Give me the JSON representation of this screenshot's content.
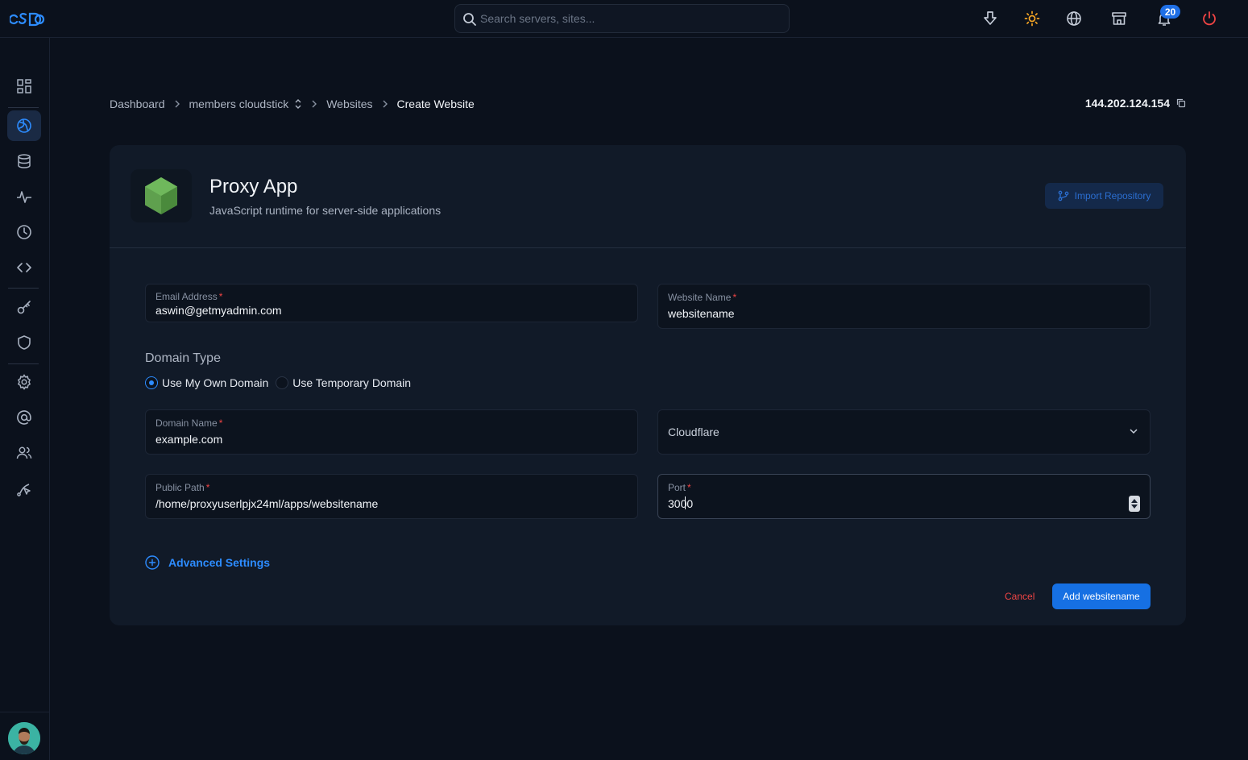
{
  "topbar": {
    "search_placeholder": "Search servers, sites...",
    "notification_count": "20"
  },
  "breadcrumb": {
    "items": [
      "Dashboard",
      "members cloudstick",
      "Websites",
      "Create Website"
    ]
  },
  "server_ip": "144.202.124.154",
  "app": {
    "title": "Proxy App",
    "subtitle": "JavaScript runtime for server-side applications",
    "import_label": "Import Repository"
  },
  "form": {
    "email": {
      "label": "Email Address",
      "value": "aswin@getmyadmin.com"
    },
    "website_name": {
      "label": "Website Name",
      "value": "websitename"
    },
    "domain_type": {
      "title": "Domain Type",
      "options": [
        "Use My Own Domain",
        "Use Temporary Domain"
      ],
      "selected": "Use My Own Domain"
    },
    "domain_name": {
      "label": "Domain Name",
      "value": "example.com"
    },
    "dns_provider": {
      "value": "Cloudflare"
    },
    "public_path": {
      "label": "Public Path",
      "value": "/home/proxyuserlpjx24ml/apps/websitename"
    },
    "port": {
      "label": "Port",
      "value": "3000"
    },
    "required_mark": "*"
  },
  "advanced_label": "Advanced Settings",
  "actions": {
    "cancel": "Cancel",
    "submit": "Add websitename"
  },
  "colors": {
    "accent": "#2d8cff",
    "danger": "#ef4444",
    "background": "#0b111c",
    "card": "#111a28",
    "node_green": "#5fa04e"
  }
}
